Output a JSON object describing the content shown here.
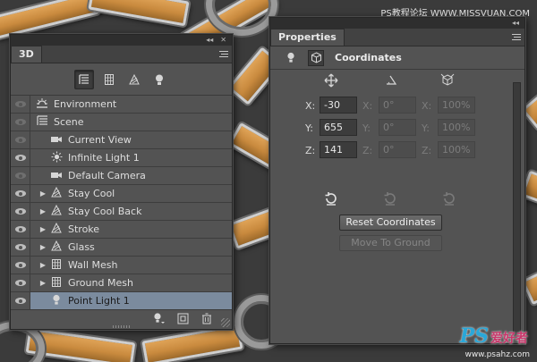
{
  "watermark": {
    "top": "PS教程论坛 WWW.MISSVUAN.COM",
    "logo_ps": "PS",
    "logo_cn": "爱好者",
    "url": "www.psahz.com"
  },
  "panel3d": {
    "tab": "3D",
    "topbar_collapse": "◂◂",
    "topbar_close": "✕",
    "filters": [
      {
        "icon": "scene-filter-icon",
        "active": true
      },
      {
        "icon": "mesh-filter-icon",
        "active": false
      },
      {
        "icon": "material-filter-icon",
        "active": false
      },
      {
        "icon": "light-filter-icon",
        "active": false
      }
    ],
    "layers": [
      {
        "label": "Environment",
        "icon": "environment-icon",
        "indent": 0,
        "expandable": false,
        "visible": false,
        "selected": false
      },
      {
        "label": "Scene",
        "icon": "scene-icon",
        "indent": 0,
        "expandable": false,
        "visible": false,
        "selected": false
      },
      {
        "label": "Current View",
        "icon": "camera-icon",
        "indent": 1,
        "expandable": false,
        "visible": false,
        "selected": false
      },
      {
        "label": "Infinite Light 1",
        "icon": "infinite-light-icon",
        "indent": 1,
        "expandable": false,
        "visible": true,
        "selected": false
      },
      {
        "label": "Default Camera",
        "icon": "camera-icon",
        "indent": 1,
        "expandable": false,
        "visible": false,
        "selected": false
      },
      {
        "label": "Stay  Cool",
        "icon": "mesh-icon",
        "indent": 1,
        "expandable": true,
        "visible": true,
        "selected": false
      },
      {
        "label": "Stay  Cool Back",
        "icon": "mesh-icon",
        "indent": 1,
        "expandable": true,
        "visible": true,
        "selected": false
      },
      {
        "label": "Stroke",
        "icon": "mesh-icon",
        "indent": 1,
        "expandable": true,
        "visible": true,
        "selected": false
      },
      {
        "label": "Glass",
        "icon": "mesh-icon",
        "indent": 1,
        "expandable": true,
        "visible": true,
        "selected": false
      },
      {
        "label": "Wall Mesh",
        "icon": "plane-mesh-icon",
        "indent": 1,
        "expandable": true,
        "visible": true,
        "selected": false
      },
      {
        "label": "Ground Mesh",
        "icon": "plane-mesh-icon",
        "indent": 1,
        "expandable": true,
        "visible": true,
        "selected": false
      },
      {
        "label": "Point Light 1",
        "icon": "point-light-icon",
        "indent": 1,
        "expandable": false,
        "visible": true,
        "selected": true
      }
    ],
    "bottom_icons": [
      "add-light-icon",
      "add-object-icon",
      "trash-icon"
    ]
  },
  "properties": {
    "tab": "Properties",
    "title": "Coordinates",
    "topbar_collapse": "◂◂",
    "col_icons": [
      "move-icon",
      "rotate-angle-icon",
      "scale-cube-icon"
    ],
    "rows": [
      {
        "axis": "X:",
        "pos": "-30",
        "rot_label": "X:",
        "rot": "0°",
        "scale_label": "X:",
        "scale": "100%"
      },
      {
        "axis": "Y:",
        "pos": "655",
        "rot_label": "Y:",
        "rot": "0°",
        "scale_label": "Y:",
        "scale": "100%"
      },
      {
        "axis": "Z:",
        "pos": "141",
        "rot_label": "Z:",
        "rot": "0°",
        "scale_label": "Z:",
        "scale": "100%"
      }
    ],
    "reset_button": "Reset Coordinates",
    "move_button": "Move To Ground"
  }
}
